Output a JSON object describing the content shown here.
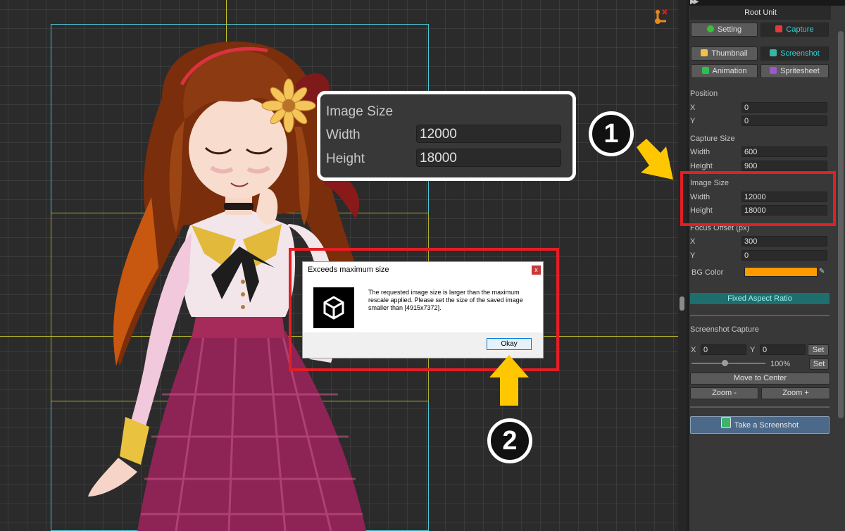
{
  "callout_zoom": {
    "title": "Image Size",
    "width_label": "Width",
    "width_value": "12000",
    "height_label": "Height",
    "height_value": "18000"
  },
  "step_badges": [
    "1",
    "2"
  ],
  "dialog": {
    "title": "Exceeds maximum size",
    "close_glyph": "x",
    "message": "The requested image size is larger than the maximum rescale applied. Please set the size of the saved image smaller than [4915x7372].",
    "ok_label": "Okay"
  },
  "panel": {
    "header_icon": "▶▶",
    "root_title": "Root Unit",
    "tabs": [
      {
        "label": "Setting",
        "icon": "settings-icon",
        "color": "#3bbf3b",
        "selected": false
      },
      {
        "label": "Capture",
        "icon": "capture-icon",
        "color": "#e43a3a",
        "selected": true
      }
    ],
    "modes": [
      {
        "label": "Thumbnail",
        "icon": "thumbnail-icon",
        "color": "#f2c14a",
        "selected": false
      },
      {
        "label": "Screenshot",
        "icon": "screenshot-icon",
        "color": "#39b5a3",
        "selected": true
      },
      {
        "label": "Animation",
        "icon": "animation-icon",
        "color": "#2fbf55",
        "selected": false
      },
      {
        "label": "Spritesheet",
        "icon": "spritesheet-icon",
        "color": "#9a58c9",
        "selected": false
      }
    ],
    "position": {
      "heading": "Position",
      "x_label": "X",
      "x_value": "0",
      "y_label": "Y",
      "y_value": "0"
    },
    "capture_size": {
      "heading": "Capture Size",
      "width_label": "Width",
      "width_value": "600",
      "height_label": "Height",
      "height_value": "900"
    },
    "image_size": {
      "heading": "Image Size",
      "width_label": "Width",
      "width_value": "12000",
      "height_label": "Height",
      "height_value": "18000"
    },
    "focus_offset": {
      "heading": "Focus Offset (px)",
      "x_label": "X",
      "x_value": "300",
      "y_label": "Y",
      "y_value": "0"
    },
    "bg_color": {
      "label": "BG Color",
      "value": "#ff9a00"
    },
    "fixed_aspect_label": "Fixed Aspect Ratio",
    "screenshot_capture": {
      "heading": "Screenshot Capture",
      "x_label": "X",
      "x_value": "0",
      "y_label": "Y",
      "y_value": "0",
      "set_label": "Set",
      "zoom_percent": "100%",
      "zoom_level": 0.45,
      "set_zoom_label": "Set",
      "move_center_label": "Move to Center",
      "zoom_out_label": "Zoom -",
      "zoom_in_label": "Zoom +"
    },
    "take_screenshot_label": "Take a Screenshot"
  },
  "colors": {
    "highlight_red": "#e41e25",
    "arrow_yellow": "#ffc700",
    "frame_cyan": "#4fc6d6",
    "guide_yellow": "#c7c72a",
    "accent_teal": "#2fd4d4"
  }
}
